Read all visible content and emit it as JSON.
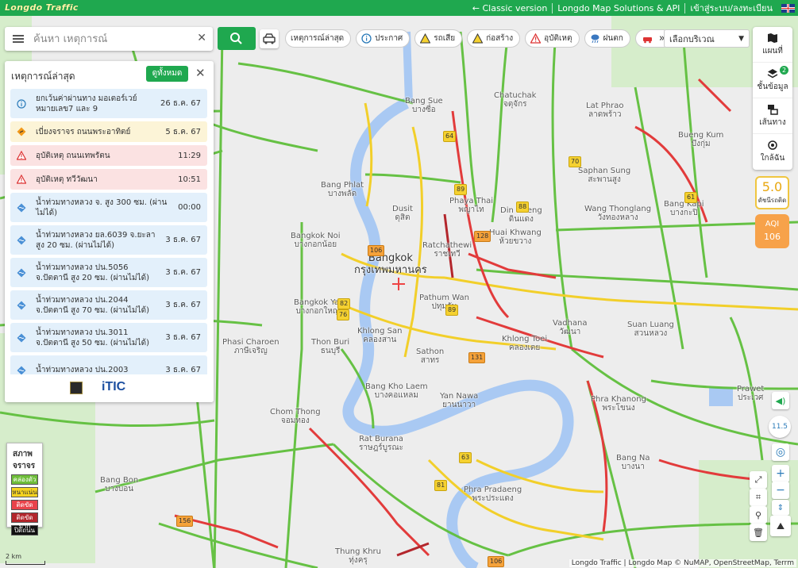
{
  "header": {
    "logo": "Longdo Traffic",
    "links": [
      "← Classic version",
      "Longdo Map Solutions & API",
      "เข้าสู่ระบบ/ลงทะเบียน"
    ],
    "language_flag": "uk-flag-icon"
  },
  "search": {
    "placeholder": "ค้นหา เหตุการณ์",
    "value": ""
  },
  "filters": {
    "chips": [
      "เหตุการณ์ล่าสุด",
      "ประกาศ",
      "รถเสีย",
      "ก่อสร้าง",
      "อุบัติเหตุ",
      "ฝนตก"
    ],
    "more": "»",
    "area_select": "เลือกบริเวณ"
  },
  "right_rail": {
    "items": [
      "แผนที่",
      "ชั้นข้อมูล",
      "เส้นทาง",
      "ใกล้ฉัน"
    ],
    "layers_badge": "2",
    "rain_value": "5.0",
    "rain_label": "ดัชนีรถติด",
    "aqi_label": "AQI",
    "aqi_value": "106",
    "zoom_level": "11.5"
  },
  "events_panel": {
    "title": "เหตุการณ์ล่าสุด",
    "view_all": "ดูทั้งหมด",
    "events": [
      {
        "text": "ยกเว้นค่าผ่านทาง มอเตอร์เวย์ หมายเลข7 และ 9",
        "time": "26 ธ.ค. 67",
        "type": "info"
      },
      {
        "text": "เบี่ยงจราจร ถนนพระอาทิตย์",
        "time": "5 ธ.ค. 67",
        "type": "construction"
      },
      {
        "text": "อุบัติเหตุ ถนนเทพรัตน",
        "time": "11:29",
        "type": "accident"
      },
      {
        "text": "อุบัติเหตุ ทวีวัฒนา",
        "time": "10:51",
        "type": "accident"
      },
      {
        "text": "น้ำท่วมทางหลวง จ. สูง 300 ซม. (ผ่านไม่ได้)",
        "time": "00:00",
        "type": "flood"
      },
      {
        "text": "น้ำท่วมทางหลวง ยล.6039 จ.ยะลา สูง 20 ซม. (ผ่านไม่ได้)",
        "time": "3 ธ.ค. 67",
        "type": "flood"
      },
      {
        "text": "น้ำท่วมทางหลวง ปน.5056 จ.ปัตตานี สูง 20 ซม. (ผ่านไม่ได้)",
        "time": "3 ธ.ค. 67",
        "type": "flood"
      },
      {
        "text": "น้ำท่วมทางหลวง ปน.2044 จ.ปัตตานี สูง 70 ซม. (ผ่านไม่ได้)",
        "time": "3 ธ.ค. 67",
        "type": "flood"
      },
      {
        "text": "น้ำท่วมทางหลวง ปน.3011 จ.ปัตตานี สูง 50 ซม. (ผ่านไม่ได้)",
        "time": "3 ธ.ค. 67",
        "type": "flood"
      },
      {
        "text": "น้ำท่วมทางหลวง ปน.2003",
        "time": "3 ธ.ค. 67",
        "type": "flood"
      }
    ],
    "footer_logos": [
      "itic-logo"
    ],
    "footer_itic": "iTIC"
  },
  "legend": {
    "title": "สภาพจราจร",
    "items": [
      {
        "label": "คล่องตัว",
        "color": "#6fbe3a"
      },
      {
        "label": "หนาแน่น",
        "color": "#f5d320"
      },
      {
        "label": "ติดขัด",
        "color": "#e9434b"
      },
      {
        "label": "ติดขัดมาก",
        "color": "#b3262c"
      },
      {
        "label": "ปิดถนน",
        "color": "#111111"
      }
    ]
  },
  "map": {
    "labels": {
      "bangkok_en": "Bangkok",
      "bangkok_th": "กรุงเทพมหานคร",
      "chatuchak": "Chatuchak\nจตุจักร",
      "lat_phrao": "Lat Phrao\nลาดพร้าว",
      "bang_sue": "Bang Sue\nบางซื่อ",
      "bueng_kum": "Bueng Kum\nบึงกุ่ม",
      "bang_phlat": "Bang Phlat\nบางพลัด",
      "dusit": "Dusit\nดุสิต",
      "phaya_thai": "Phaya Thai\nพญาไท",
      "din_daeng": "Din Daeng\nดินแดง",
      "wang_thonglang": "Wang Thonglang\nวังทองหลาง",
      "bang_kapi": "Bang Kapi\nบางกะปิ",
      "bangkok_noi": "Bangkok Noi\nบางกอกน้อย",
      "ratchathewi": "Ratchathewi\nราชเทวี",
      "huai_khwang": "Huai Khwang\nห้วยขวาง",
      "pathum_wan": "Pathum Wan\nปทุมวัน",
      "bangkok_yai": "Bangkok Yai\nบางกอกใหญ่",
      "khlong_san": "Khlong San\nคลองสาน",
      "khlong_toei": "Khlong Toei\nคลองเตย",
      "vadhana": "Vadhana\nวัฒนา",
      "suan_luang": "Suan Luang\nสวนหลวง",
      "phasi_charoen": "Phasi Charoen\nภาษีเจริญ",
      "thon_buri": "Thon Buri\nธนบุรี",
      "sathon": "Sathon\nสาทร",
      "bang_kho_laem": "Bang Kho Laem\nบางคอแหลม",
      "yan_nawa": "Yan Nawa\nยานนาวา",
      "phra_khanong": "Phra Khanong\nพระโขนง",
      "prawet": "Prawet\nประเวศ",
      "chom_thong": "Chom Thong\nจอมทอง",
      "rat_burana": "Rat Burana\nราษฎร์บูรณะ",
      "bang_na": "Bang Na\nบางนา",
      "bang_bon": "Bang Bon\nบางบอน",
      "thung_khru": "Thung Khru\nทุ่งครุ",
      "phra_pradaeng": "Phra Pradaeng\nพระประแดง",
      "saphan_sung": "Saphan Sung\nสะพานสูง",
      "bang_sue_th": "บางซื่อ"
    },
    "route_shields": [
      "64",
      "70",
      "89",
      "88",
      "61",
      "106",
      "128",
      "82",
      "76",
      "89",
      "131",
      "63",
      "81",
      "156",
      "106"
    ],
    "scale": "2 km"
  },
  "attribution": {
    "text": "Longdo Traffic | Longdo Map © NuMAP, OpenStreetMap, Terrm"
  }
}
